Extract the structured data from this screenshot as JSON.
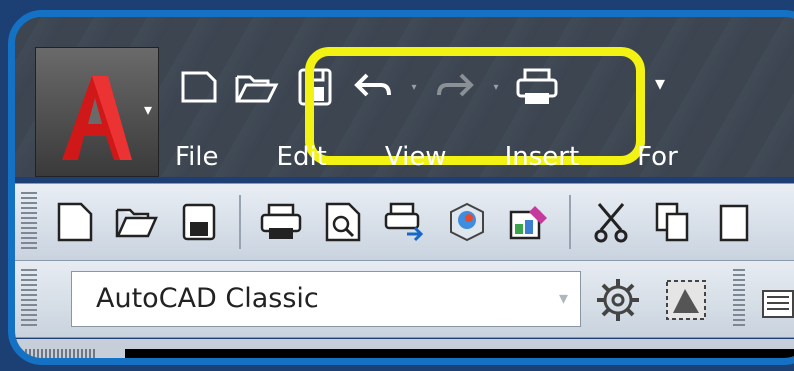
{
  "quick_access": {
    "icons": [
      "new-icon",
      "open-icon",
      "save-icon",
      "undo-icon",
      "redo-icon",
      "plot-icon"
    ],
    "overflow": "▾"
  },
  "app_button": {
    "caret": "▾"
  },
  "menu": {
    "items": [
      "File",
      "Edit",
      "View",
      "Insert",
      "For"
    ]
  },
  "toolbar": {
    "icons": [
      "new-icon",
      "open-icon",
      "save-icon",
      "plot-icon",
      "plot-preview-icon",
      "publish-icon",
      "3d-dwf-icon",
      "design-center-icon",
      "cut-icon",
      "copy-icon",
      "paste-icon"
    ]
  },
  "workspace": {
    "selected": "AutoCAD Classic",
    "arrow": "▾"
  },
  "colors": {
    "frame": "#1471c4",
    "highlight": "#f2f213",
    "background": "#1c3f74"
  }
}
